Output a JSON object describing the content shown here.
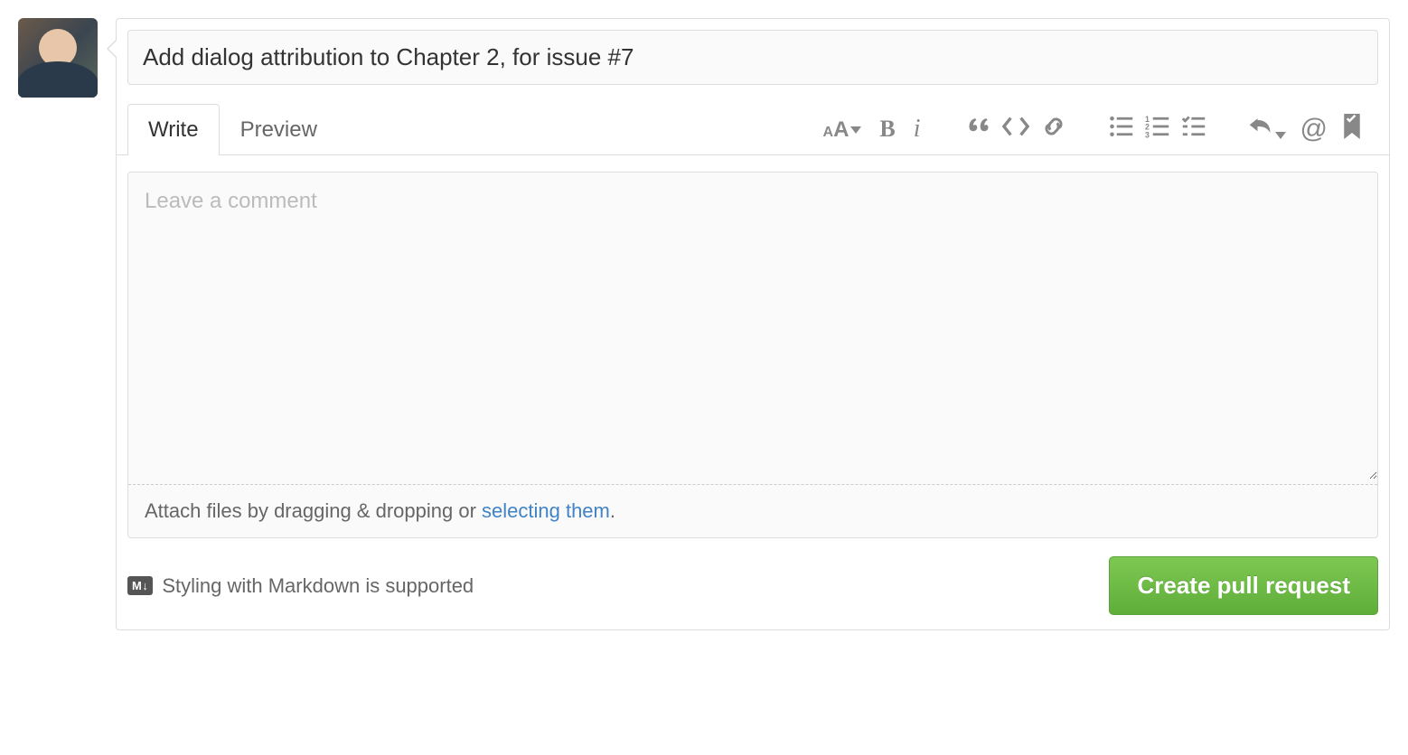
{
  "title": {
    "value": "Add dialog attribution to Chapter 2, for issue #7"
  },
  "tabs": {
    "write": "Write",
    "preview": "Preview",
    "active": "write"
  },
  "toolbar": {
    "text_size": "Text size",
    "bold": "B",
    "italic": "i",
    "quote": "Quote",
    "code": "Code",
    "link": "Link",
    "ul": "Unordered list",
    "ol": "Ordered list",
    "task": "Task list",
    "reply": "Reply",
    "mention": "@",
    "bookmark": "Saved replies"
  },
  "editor": {
    "placeholder": "Leave a comment",
    "value": ""
  },
  "attach": {
    "prefix": "Attach files by dragging & dropping or ",
    "link": "selecting them",
    "suffix": "."
  },
  "footer": {
    "markdown_badge": "M↓",
    "markdown_text": "Styling with Markdown is supported",
    "submit": "Create pull request"
  }
}
